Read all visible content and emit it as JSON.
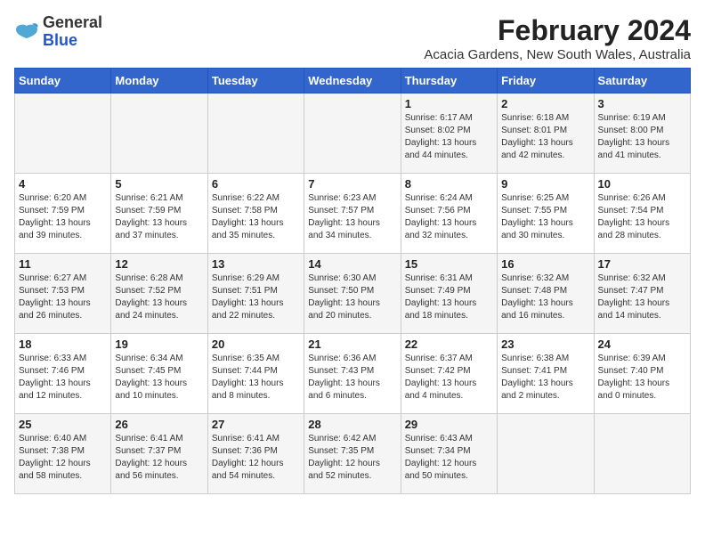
{
  "header": {
    "logo_line1": "General",
    "logo_line2": "Blue",
    "month_year": "February 2024",
    "location": "Acacia Gardens, New South Wales, Australia"
  },
  "days_of_week": [
    "Sunday",
    "Monday",
    "Tuesday",
    "Wednesday",
    "Thursday",
    "Friday",
    "Saturday"
  ],
  "weeks": [
    [
      {
        "day": "",
        "info": ""
      },
      {
        "day": "",
        "info": ""
      },
      {
        "day": "",
        "info": ""
      },
      {
        "day": "",
        "info": ""
      },
      {
        "day": "1",
        "info": "Sunrise: 6:17 AM\nSunset: 8:02 PM\nDaylight: 13 hours\nand 44 minutes."
      },
      {
        "day": "2",
        "info": "Sunrise: 6:18 AM\nSunset: 8:01 PM\nDaylight: 13 hours\nand 42 minutes."
      },
      {
        "day": "3",
        "info": "Sunrise: 6:19 AM\nSunset: 8:00 PM\nDaylight: 13 hours\nand 41 minutes."
      }
    ],
    [
      {
        "day": "4",
        "info": "Sunrise: 6:20 AM\nSunset: 7:59 PM\nDaylight: 13 hours\nand 39 minutes."
      },
      {
        "day": "5",
        "info": "Sunrise: 6:21 AM\nSunset: 7:59 PM\nDaylight: 13 hours\nand 37 minutes."
      },
      {
        "day": "6",
        "info": "Sunrise: 6:22 AM\nSunset: 7:58 PM\nDaylight: 13 hours\nand 35 minutes."
      },
      {
        "day": "7",
        "info": "Sunrise: 6:23 AM\nSunset: 7:57 PM\nDaylight: 13 hours\nand 34 minutes."
      },
      {
        "day": "8",
        "info": "Sunrise: 6:24 AM\nSunset: 7:56 PM\nDaylight: 13 hours\nand 32 minutes."
      },
      {
        "day": "9",
        "info": "Sunrise: 6:25 AM\nSunset: 7:55 PM\nDaylight: 13 hours\nand 30 minutes."
      },
      {
        "day": "10",
        "info": "Sunrise: 6:26 AM\nSunset: 7:54 PM\nDaylight: 13 hours\nand 28 minutes."
      }
    ],
    [
      {
        "day": "11",
        "info": "Sunrise: 6:27 AM\nSunset: 7:53 PM\nDaylight: 13 hours\nand 26 minutes."
      },
      {
        "day": "12",
        "info": "Sunrise: 6:28 AM\nSunset: 7:52 PM\nDaylight: 13 hours\nand 24 minutes."
      },
      {
        "day": "13",
        "info": "Sunrise: 6:29 AM\nSunset: 7:51 PM\nDaylight: 13 hours\nand 22 minutes."
      },
      {
        "day": "14",
        "info": "Sunrise: 6:30 AM\nSunset: 7:50 PM\nDaylight: 13 hours\nand 20 minutes."
      },
      {
        "day": "15",
        "info": "Sunrise: 6:31 AM\nSunset: 7:49 PM\nDaylight: 13 hours\nand 18 minutes."
      },
      {
        "day": "16",
        "info": "Sunrise: 6:32 AM\nSunset: 7:48 PM\nDaylight: 13 hours\nand 16 minutes."
      },
      {
        "day": "17",
        "info": "Sunrise: 6:32 AM\nSunset: 7:47 PM\nDaylight: 13 hours\nand 14 minutes."
      }
    ],
    [
      {
        "day": "18",
        "info": "Sunrise: 6:33 AM\nSunset: 7:46 PM\nDaylight: 13 hours\nand 12 minutes."
      },
      {
        "day": "19",
        "info": "Sunrise: 6:34 AM\nSunset: 7:45 PM\nDaylight: 13 hours\nand 10 minutes."
      },
      {
        "day": "20",
        "info": "Sunrise: 6:35 AM\nSunset: 7:44 PM\nDaylight: 13 hours\nand 8 minutes."
      },
      {
        "day": "21",
        "info": "Sunrise: 6:36 AM\nSunset: 7:43 PM\nDaylight: 13 hours\nand 6 minutes."
      },
      {
        "day": "22",
        "info": "Sunrise: 6:37 AM\nSunset: 7:42 PM\nDaylight: 13 hours\nand 4 minutes."
      },
      {
        "day": "23",
        "info": "Sunrise: 6:38 AM\nSunset: 7:41 PM\nDaylight: 13 hours\nand 2 minutes."
      },
      {
        "day": "24",
        "info": "Sunrise: 6:39 AM\nSunset: 7:40 PM\nDaylight: 13 hours\nand 0 minutes."
      }
    ],
    [
      {
        "day": "25",
        "info": "Sunrise: 6:40 AM\nSunset: 7:38 PM\nDaylight: 12 hours\nand 58 minutes."
      },
      {
        "day": "26",
        "info": "Sunrise: 6:41 AM\nSunset: 7:37 PM\nDaylight: 12 hours\nand 56 minutes."
      },
      {
        "day": "27",
        "info": "Sunrise: 6:41 AM\nSunset: 7:36 PM\nDaylight: 12 hours\nand 54 minutes."
      },
      {
        "day": "28",
        "info": "Sunrise: 6:42 AM\nSunset: 7:35 PM\nDaylight: 12 hours\nand 52 minutes."
      },
      {
        "day": "29",
        "info": "Sunrise: 6:43 AM\nSunset: 7:34 PM\nDaylight: 12 hours\nand 50 minutes."
      },
      {
        "day": "",
        "info": ""
      },
      {
        "day": "",
        "info": ""
      }
    ]
  ]
}
